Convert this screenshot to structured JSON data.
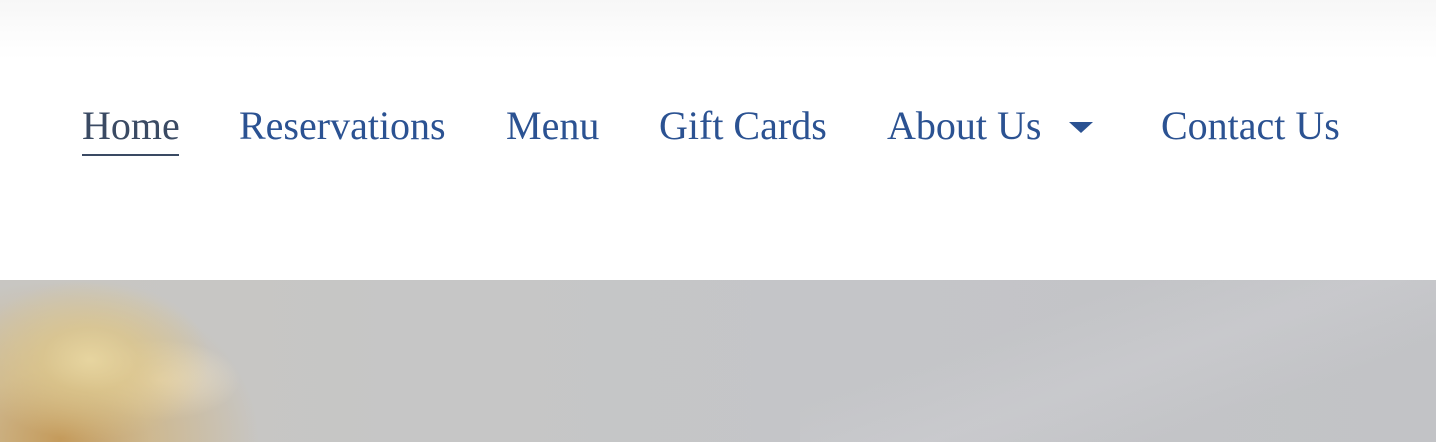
{
  "nav": {
    "items": [
      {
        "label": "Home",
        "active": true
      },
      {
        "label": "Reservations",
        "active": false
      },
      {
        "label": "Menu",
        "active": false
      },
      {
        "label": "Gift Cards",
        "active": false
      },
      {
        "label": "About Us",
        "active": false,
        "has_dropdown": true
      },
      {
        "label": "Contact Us",
        "active": false
      }
    ],
    "caret_icon": "caret-down-icon"
  },
  "colors": {
    "link": "#2b5292",
    "active_link": "#3a4a63",
    "header_bg": "#ffffff",
    "hero_bg": "#c6c6c6"
  }
}
